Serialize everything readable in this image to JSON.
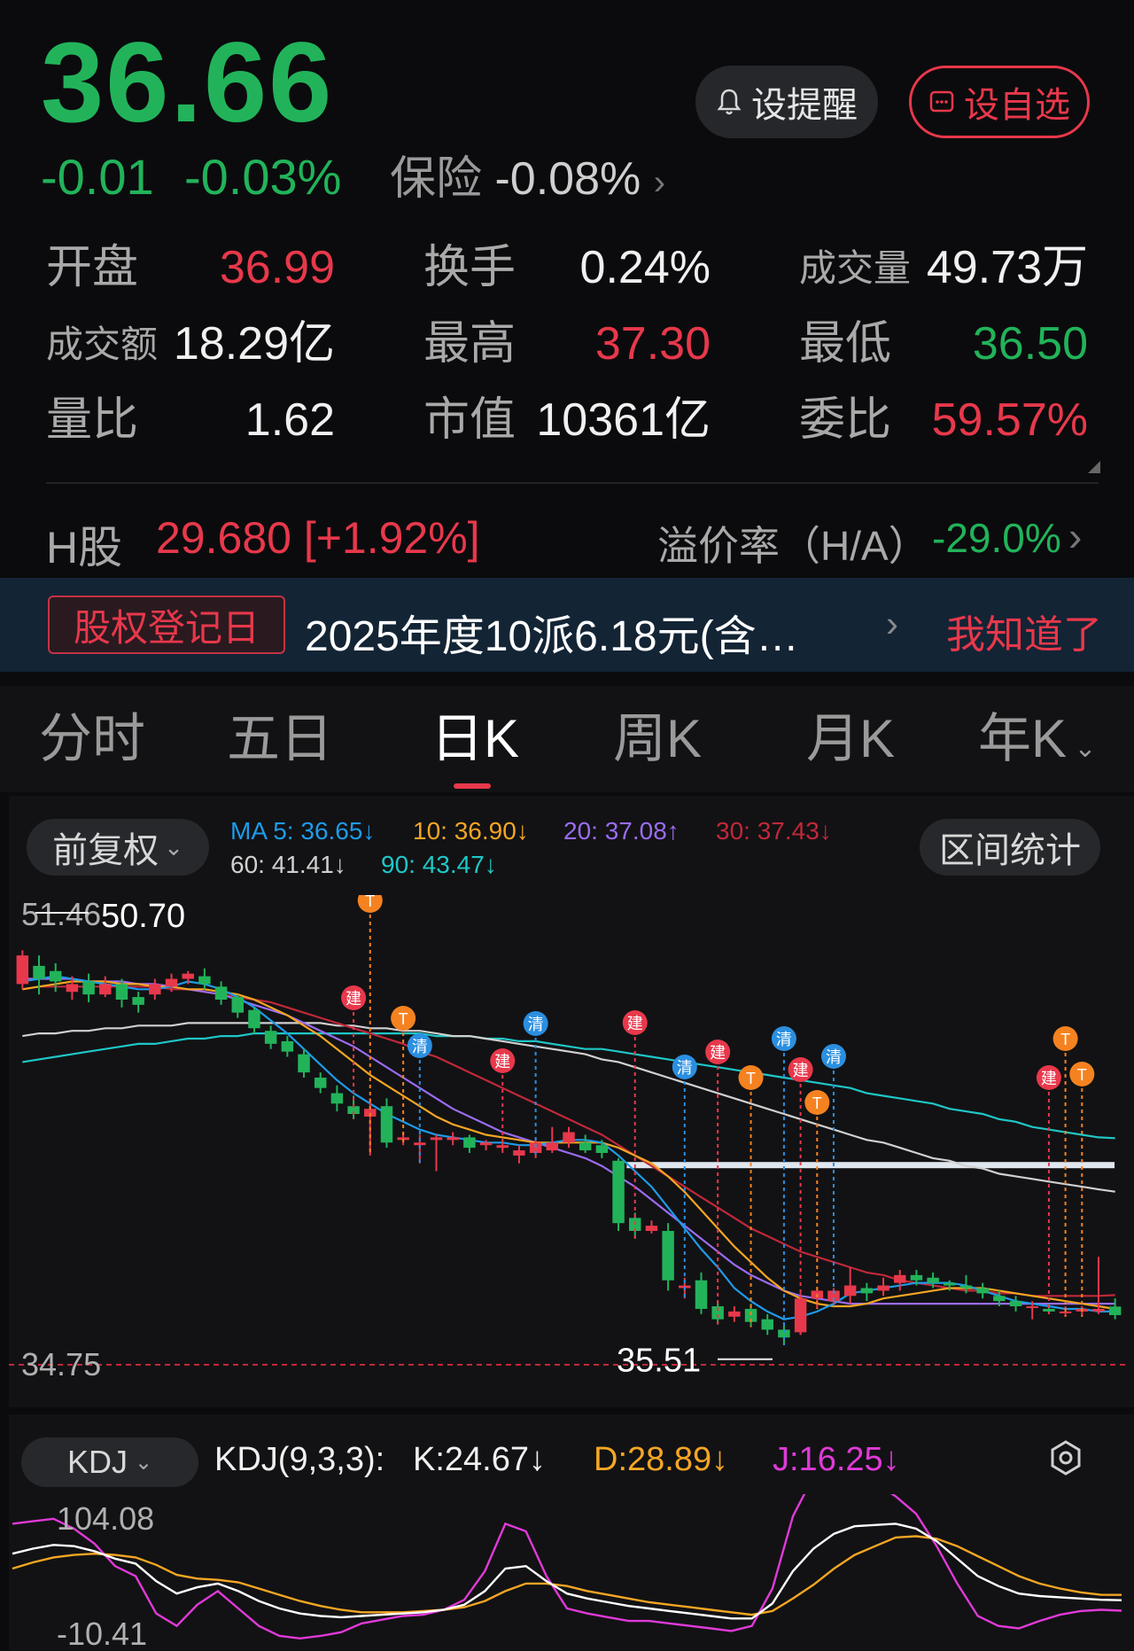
{
  "header": {
    "price": "36.66",
    "change": "-0.01",
    "change_pct": "-0.03%",
    "sector_name": "保险",
    "sector_pct": "-0.08%",
    "remind_label": "设提醒",
    "favorite_label": "设自选"
  },
  "stats": {
    "open_label": "开盘",
    "open": "36.99",
    "turnover_label": "换手",
    "turnover": "0.24%",
    "volume_label": "成交量",
    "volume": "49.73万",
    "amount_label": "成交额",
    "amount": "18.29亿",
    "high_label": "最高",
    "high": "37.30",
    "low_label": "最低",
    "low": "36.50",
    "vol_ratio_label": "量比",
    "vol_ratio": "1.62",
    "mkt_cap_label": "市值",
    "mkt_cap": "10361亿",
    "bid_ratio_label": "委比",
    "bid_ratio": "59.57%"
  },
  "hshare": {
    "label": "H股",
    "value": "29.680 [+1.92%]",
    "premium_label": "溢价率（H/A）",
    "premium": "-29.0%"
  },
  "notice": {
    "tag": "股权登记日",
    "text": "2025年度10派6.18元(含…",
    "dismiss": "我知道了"
  },
  "tabs": [
    "分时",
    "五日",
    "日K",
    "周K",
    "月K",
    "年K"
  ],
  "active_tab": "日K",
  "chart_controls": {
    "adjust_label": "前复权",
    "range_stats_label": "区间统计",
    "ma5": "MA 5: 36.65↓",
    "ma10": "10: 36.90↓",
    "ma20": "20: 37.08↑",
    "ma30": "30: 37.43↓",
    "ma60": "60: 41.41↓",
    "ma90": "90: 43.47↓"
  },
  "chart_labels": {
    "y_top": "51.46",
    "y_bottom": "34.75",
    "max_marker": "50.70",
    "min_marker": "35.51"
  },
  "signals": {
    "build": "建",
    "clear": "清",
    "t": "T"
  },
  "kdj": {
    "selector": "KDJ",
    "params": "KDJ(9,3,3):",
    "k": "K:24.67↓",
    "d": "D:28.89↓",
    "j": "J:16.25↓",
    "y_top": "104.08",
    "y_bottom": "-10.41"
  },
  "colors": {
    "up": "#e8384b",
    "down": "#22b35a",
    "ma5": "#1e9be9",
    "ma10": "#f5a623",
    "ma20": "#9b6cf2",
    "ma30": "#c0283a",
    "ma60": "#d0d0d0",
    "ma90": "#1fc7c7"
  },
  "chart_data": {
    "type": "candlestick",
    "y_range": [
      34.75,
      51.46
    ],
    "candles": [
      {
        "o": 49.4,
        "c": 50.5,
        "h": 50.7,
        "l": 49.2
      },
      {
        "o": 50.1,
        "c": 49.6,
        "h": 50.5,
        "l": 49.0
      },
      {
        "o": 49.9,
        "c": 49.5,
        "h": 50.2,
        "l": 49.1
      },
      {
        "o": 49.1,
        "c": 49.4,
        "h": 49.7,
        "l": 48.8
      },
      {
        "o": 49.5,
        "c": 49.0,
        "h": 49.8,
        "l": 48.7
      },
      {
        "o": 49.0,
        "c": 49.4,
        "h": 49.7,
        "l": 48.9
      },
      {
        "o": 49.4,
        "c": 48.8,
        "h": 49.6,
        "l": 48.5
      },
      {
        "o": 48.9,
        "c": 48.6,
        "h": 49.1,
        "l": 48.3
      },
      {
        "o": 49.0,
        "c": 49.4,
        "h": 49.6,
        "l": 48.8
      },
      {
        "o": 49.3,
        "c": 49.6,
        "h": 49.8,
        "l": 49.1
      },
      {
        "o": 49.6,
        "c": 49.8,
        "h": 49.9,
        "l": 49.4
      },
      {
        "o": 49.7,
        "c": 49.4,
        "h": 50.0,
        "l": 49.2
      },
      {
        "o": 49.3,
        "c": 48.8,
        "h": 49.5,
        "l": 48.6
      },
      {
        "o": 48.9,
        "c": 48.3,
        "h": 49.0,
        "l": 48.1
      },
      {
        "o": 48.4,
        "c": 47.7,
        "h": 48.5,
        "l": 47.5
      },
      {
        "o": 47.6,
        "c": 47.1,
        "h": 47.8,
        "l": 46.9
      },
      {
        "o": 47.2,
        "c": 46.8,
        "h": 47.4,
        "l": 46.6
      },
      {
        "o": 46.7,
        "c": 46.0,
        "h": 46.9,
        "l": 45.8
      },
      {
        "o": 45.8,
        "c": 45.4,
        "h": 46.0,
        "l": 45.2
      },
      {
        "o": 45.2,
        "c": 44.8,
        "h": 45.5,
        "l": 44.5
      },
      {
        "o": 44.7,
        "c": 44.4,
        "h": 45.1,
        "l": 44.2
      },
      {
        "o": 44.3,
        "c": 44.6,
        "h": 45.0,
        "l": 42.8
      },
      {
        "o": 44.7,
        "c": 43.3,
        "h": 45.0,
        "l": 43.1
      },
      {
        "o": 43.4,
        "c": 43.5,
        "h": 43.7,
        "l": 43.2
      },
      {
        "o": 43.2,
        "c": 43.3,
        "h": 43.6,
        "l": 42.5
      },
      {
        "o": 43.4,
        "c": 43.5,
        "h": 43.6,
        "l": 42.2
      },
      {
        "o": 43.4,
        "c": 43.5,
        "h": 43.7,
        "l": 43.2
      },
      {
        "o": 43.5,
        "c": 43.1,
        "h": 43.6,
        "l": 42.9
      },
      {
        "o": 43.2,
        "c": 43.3,
        "h": 43.4,
        "l": 43.0
      },
      {
        "o": 43.1,
        "c": 43.2,
        "h": 43.3,
        "l": 42.9
      },
      {
        "o": 42.8,
        "c": 43.0,
        "h": 43.2,
        "l": 42.5
      },
      {
        "o": 42.9,
        "c": 43.3,
        "h": 43.5,
        "l": 42.7
      },
      {
        "o": 43.0,
        "c": 43.3,
        "h": 43.9,
        "l": 42.9
      },
      {
        "o": 43.3,
        "c": 43.7,
        "h": 43.9,
        "l": 43.1
      },
      {
        "o": 43.3,
        "c": 43.0,
        "h": 43.6,
        "l": 42.9
      },
      {
        "o": 43.2,
        "c": 42.9,
        "h": 43.4,
        "l": 42.7
      },
      {
        "o": 42.6,
        "c": 40.2,
        "h": 42.7,
        "l": 39.9
      },
      {
        "o": 40.4,
        "c": 39.9,
        "h": 40.6,
        "l": 39.6
      },
      {
        "o": 39.9,
        "c": 40.1,
        "h": 40.3,
        "l": 39.8
      },
      {
        "o": 39.9,
        "c": 38.0,
        "h": 40.2,
        "l": 37.6
      },
      {
        "o": 37.7,
        "c": 37.8,
        "h": 38.1,
        "l": 37.3
      },
      {
        "o": 38.0,
        "c": 36.9,
        "h": 38.3,
        "l": 36.7
      },
      {
        "o": 37.0,
        "c": 36.5,
        "h": 37.2,
        "l": 36.3
      },
      {
        "o": 36.6,
        "c": 36.8,
        "h": 37.0,
        "l": 36.4
      },
      {
        "o": 36.9,
        "c": 36.4,
        "h": 37.1,
        "l": 36.2
      },
      {
        "o": 36.5,
        "c": 36.1,
        "h": 36.7,
        "l": 35.9
      },
      {
        "o": 36.1,
        "c": 35.8,
        "h": 36.3,
        "l": 35.5
      },
      {
        "o": 36.0,
        "c": 37.3,
        "h": 37.5,
        "l": 35.9
      },
      {
        "o": 37.3,
        "c": 37.6,
        "h": 37.7,
        "l": 36.9
      },
      {
        "o": 37.2,
        "c": 37.6,
        "h": 37.7,
        "l": 37.0
      },
      {
        "o": 37.4,
        "c": 37.8,
        "h": 38.5,
        "l": 37.1
      },
      {
        "o": 37.7,
        "c": 37.5,
        "h": 37.9,
        "l": 37.2
      },
      {
        "o": 37.6,
        "c": 37.8,
        "h": 38.1,
        "l": 37.4
      },
      {
        "o": 37.9,
        "c": 38.2,
        "h": 38.4,
        "l": 37.6
      },
      {
        "o": 38.2,
        "c": 38.0,
        "h": 38.4,
        "l": 37.8
      },
      {
        "o": 38.1,
        "c": 37.9,
        "h": 38.3,
        "l": 37.7
      },
      {
        "o": 37.9,
        "c": 37.8,
        "h": 38.0,
        "l": 37.6
      },
      {
        "o": 37.8,
        "c": 37.7,
        "h": 38.2,
        "l": 37.5
      },
      {
        "o": 37.7,
        "c": 37.5,
        "h": 37.9,
        "l": 37.3
      },
      {
        "o": 37.4,
        "c": 37.2,
        "h": 37.6,
        "l": 37.0
      },
      {
        "o": 37.2,
        "c": 37.0,
        "h": 37.4,
        "l": 36.8
      },
      {
        "o": 37.0,
        "c": 37.0,
        "h": 37.2,
        "l": 36.5
      },
      {
        "o": 36.9,
        "c": 36.8,
        "h": 37.1,
        "l": 36.7
      },
      {
        "o": 36.8,
        "c": 36.8,
        "h": 37.0,
        "l": 36.6
      },
      {
        "o": 36.8,
        "c": 36.9,
        "h": 37.0,
        "l": 36.6
      },
      {
        "o": 36.8,
        "c": 36.9,
        "h": 38.9,
        "l": 36.7
      },
      {
        "o": 36.99,
        "c": 36.66,
        "h": 37.3,
        "l": 36.5
      }
    ],
    "ma5": [
      49.5,
      49.6,
      49.7,
      49.6,
      49.5,
      49.4,
      49.3,
      49.2,
      49.2,
      49.3,
      49.5,
      49.4,
      49.2,
      48.9,
      48.5,
      48.0,
      47.5,
      46.9,
      46.3,
      45.7,
      45.2,
      44.8,
      44.4,
      44.1,
      43.8,
      43.6,
      43.5,
      43.4,
      43.3,
      43.3,
      43.2,
      43.2,
      43.3,
      43.4,
      43.4,
      43.3,
      42.8,
      42.2,
      41.6,
      40.8,
      40.0,
      39.2,
      38.5,
      37.7,
      37.2,
      36.8,
      36.5,
      36.6,
      36.8,
      37.1,
      37.5,
      37.6,
      37.7,
      37.8,
      37.9,
      37.9,
      37.9,
      37.8,
      37.6,
      37.4,
      37.2,
      37.1,
      37.0,
      36.9,
      36.9,
      36.8,
      36.8
    ],
    "ma10": [
      49.2,
      49.3,
      49.4,
      49.5,
      49.5,
      49.5,
      49.4,
      49.4,
      49.3,
      49.3,
      49.2,
      49.2,
      49.1,
      49.0,
      48.8,
      48.5,
      48.2,
      47.8,
      47.4,
      46.9,
      46.4,
      45.9,
      45.5,
      45.1,
      44.7,
      44.3,
      44.0,
      43.8,
      43.6,
      43.5,
      43.4,
      43.3,
      43.3,
      43.3,
      43.3,
      43.3,
      43.1,
      42.8,
      42.5,
      42.0,
      41.4,
      40.7,
      40.0,
      39.3,
      38.7,
      38.1,
      37.6,
      37.3,
      37.1,
      37.0,
      37.0,
      37.1,
      37.3,
      37.4,
      37.5,
      37.6,
      37.7,
      37.7,
      37.7,
      37.6,
      37.5,
      37.4,
      37.3,
      37.2,
      37.1,
      37.0,
      36.9
    ],
    "ma20": [
      49.6,
      49.6,
      49.6,
      49.6,
      49.5,
      49.5,
      49.5,
      49.4,
      49.4,
      49.3,
      49.2,
      49.1,
      49.0,
      48.8,
      48.6,
      48.4,
      48.2,
      47.9,
      47.6,
      47.3,
      47.0,
      46.6,
      46.2,
      45.8,
      45.4,
      45.0,
      44.6,
      44.3,
      44.0,
      43.7,
      43.5,
      43.3,
      43.1,
      42.9,
      42.7,
      42.4,
      42.0,
      41.6,
      41.1,
      40.6,
      40.1,
      39.6,
      39.1,
      38.6,
      38.2,
      37.9,
      37.6,
      37.4,
      37.3,
      37.2,
      37.1,
      37.1,
      37.1,
      37.1,
      37.1,
      37.1,
      37.1,
      37.1,
      37.1,
      37.1,
      37.1,
      37.1,
      37.1,
      37.1,
      37.1,
      37.1,
      37.1
    ],
    "ma30": [
      49.2,
      49.3,
      49.3,
      49.3,
      49.3,
      49.3,
      49.3,
      49.3,
      49.3,
      49.2,
      49.2,
      49.1,
      49.0,
      48.9,
      48.8,
      48.7,
      48.5,
      48.3,
      48.1,
      47.9,
      47.7,
      47.5,
      47.3,
      47.1,
      46.8,
      46.6,
      46.3,
      46.0,
      45.7,
      45.4,
      45.1,
      44.8,
      44.5,
      44.2,
      43.9,
      43.6,
      43.2,
      42.8,
      42.4,
      42.0,
      41.6,
      41.2,
      40.8,
      40.4,
      40.0,
      39.7,
      39.4,
      39.1,
      38.9,
      38.7,
      38.5,
      38.3,
      38.2,
      38.0,
      37.9,
      37.8,
      37.7,
      37.6,
      37.6,
      37.5,
      37.5,
      37.4,
      37.4,
      37.4,
      37.4,
      37.4,
      37.43
    ],
    "ma60": [
      47.4,
      47.5,
      47.5,
      47.6,
      47.6,
      47.7,
      47.7,
      47.8,
      47.8,
      47.8,
      47.9,
      47.9,
      47.9,
      47.9,
      47.9,
      47.9,
      47.9,
      47.9,
      47.9,
      47.8,
      47.8,
      47.7,
      47.7,
      47.6,
      47.6,
      47.5,
      47.4,
      47.4,
      47.3,
      47.2,
      47.1,
      47.0,
      46.9,
      46.8,
      46.7,
      46.5,
      46.4,
      46.2,
      46.0,
      45.8,
      45.6,
      45.4,
      45.2,
      45.0,
      44.8,
      44.6,
      44.4,
      44.2,
      44.0,
      43.8,
      43.6,
      43.4,
      43.3,
      43.1,
      42.9,
      42.7,
      42.6,
      42.4,
      42.3,
      42.1,
      42.0,
      41.9,
      41.8,
      41.7,
      41.6,
      41.5,
      41.41
    ],
    "ma90": [
      46.4,
      46.5,
      46.6,
      46.7,
      46.8,
      46.9,
      47.0,
      47.1,
      47.1,
      47.2,
      47.3,
      47.3,
      47.4,
      47.4,
      47.5,
      47.5,
      47.5,
      47.5,
      47.5,
      47.5,
      47.5,
      47.5,
      47.5,
      47.5,
      47.5,
      47.4,
      47.4,
      47.4,
      47.3,
      47.3,
      47.2,
      47.2,
      47.1,
      47.0,
      46.9,
      46.9,
      46.8,
      46.7,
      46.6,
      46.5,
      46.4,
      46.3,
      46.2,
      46.1,
      46.0,
      45.9,
      45.8,
      45.7,
      45.6,
      45.5,
      45.4,
      45.2,
      45.1,
      45.0,
      44.9,
      44.8,
      44.6,
      44.5,
      44.4,
      44.2,
      44.1,
      43.9,
      43.8,
      43.7,
      43.6,
      43.5,
      43.47
    ],
    "kdj": {
      "y_range": [
        -10.41,
        104.08
      ],
      "k": [
        62,
        66,
        69,
        68,
        64,
        58,
        54,
        40,
        30,
        35,
        38,
        32,
        24,
        18,
        14,
        12,
        11,
        12,
        13,
        14,
        15,
        17,
        21,
        32,
        50,
        52,
        40,
        30,
        26,
        23,
        20,
        18,
        16,
        14,
        12,
        10,
        10,
        22,
        48,
        66,
        78,
        84,
        85,
        86,
        82,
        72,
        58,
        44,
        36,
        30,
        28,
        27,
        26,
        25,
        24.67
      ],
      "d": [
        50,
        55,
        59,
        61,
        62,
        61,
        59,
        53,
        45,
        42,
        41,
        39,
        34,
        29,
        24,
        20,
        17,
        15,
        15,
        15,
        16,
        17,
        19,
        24,
        32,
        38,
        38,
        36,
        32,
        29,
        26,
        23,
        21,
        19,
        17,
        15,
        13,
        16,
        26,
        37,
        50,
        61,
        68,
        75,
        76,
        74,
        68,
        60,
        52,
        44,
        38,
        34,
        31,
        29,
        28.89
      ],
      "j": [
        86,
        88,
        90,
        82,
        70,
        52,
        44,
        14,
        4,
        21,
        32,
        18,
        4,
        -4,
        -6,
        -4,
        -1,
        6,
        9,
        12,
        13,
        17,
        25,
        48,
        86,
        80,
        44,
        18,
        14,
        11,
        8,
        8,
        6,
        4,
        2,
        0,
        4,
        34,
        92,
        124,
        134,
        130,
        119,
        108,
        94,
        68,
        38,
        12,
        4,
        2,
        8,
        13,
        16,
        17,
        16.25
      ]
    }
  }
}
